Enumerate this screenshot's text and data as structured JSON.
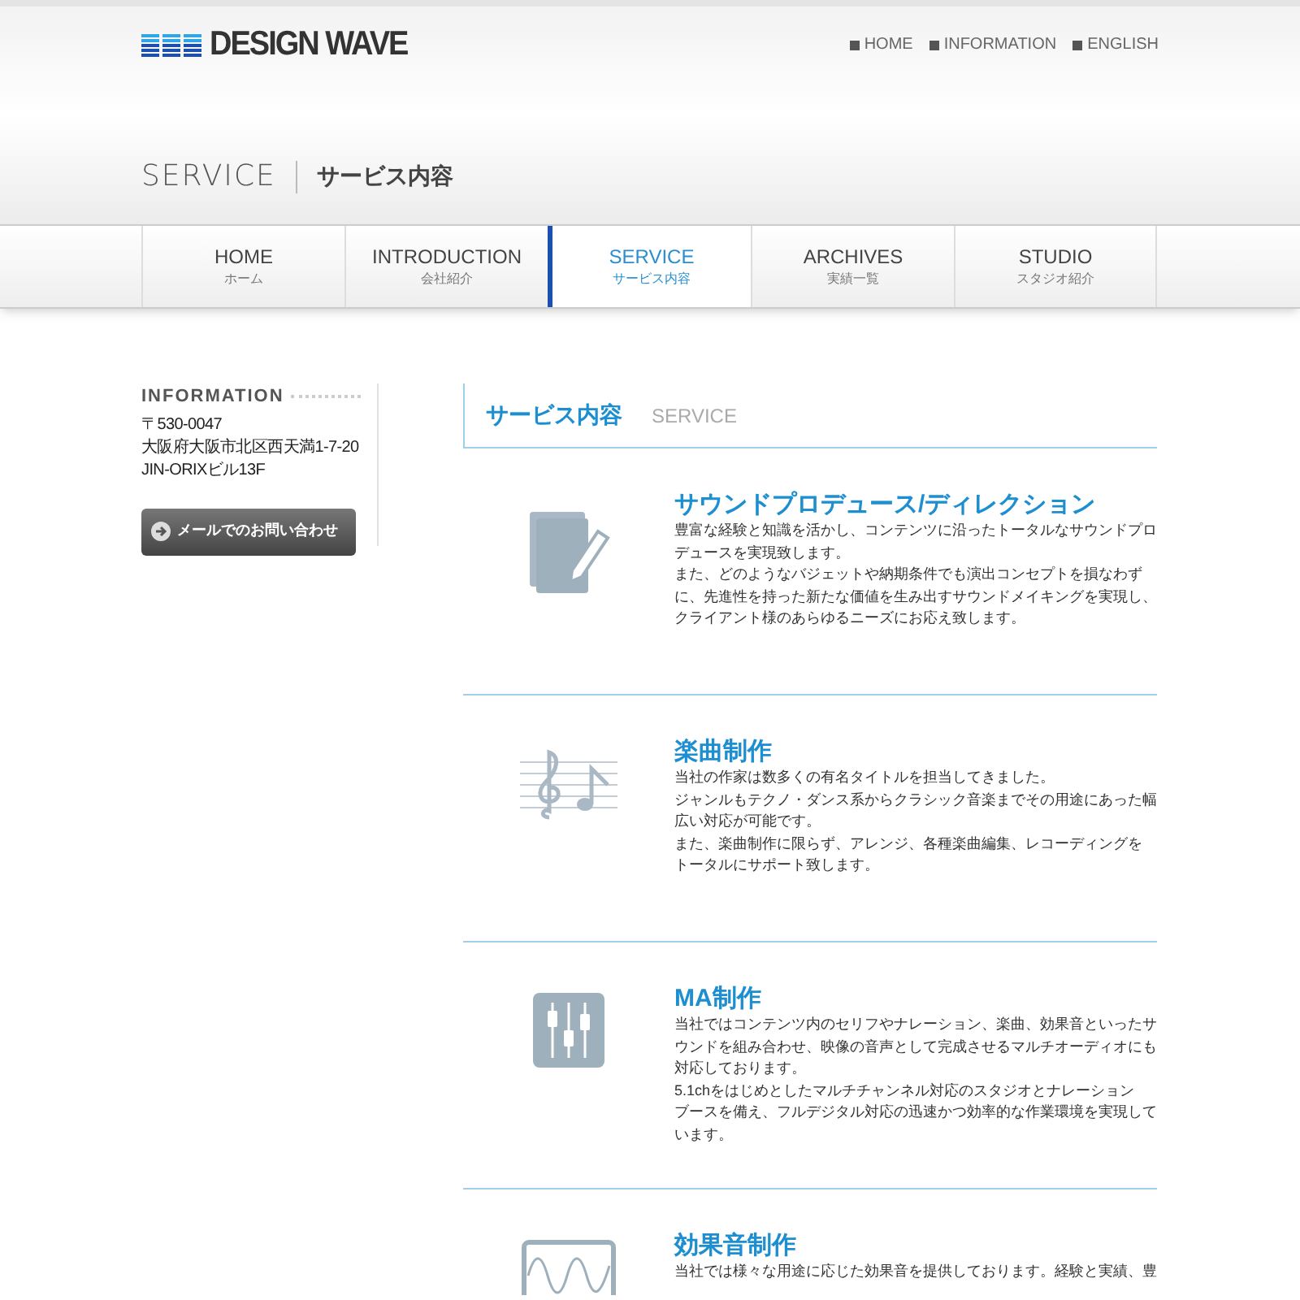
{
  "header": {
    "logo": "DESIGN WAVE",
    "links": [
      "HOME",
      "INFORMATION",
      "ENGLISH"
    ],
    "page_title": "SERVICE",
    "page_subtitle": "サービス内容"
  },
  "nav": [
    {
      "label": "HOME",
      "sub": "ホーム",
      "selected": false
    },
    {
      "label": "INTRODUCTION",
      "sub": "会社紹介",
      "selected": false
    },
    {
      "label": "SERVICE",
      "sub": "サービス内容",
      "selected": true
    },
    {
      "label": "ARCHIVES",
      "sub": "実績一覧",
      "selected": false
    },
    {
      "label": "STUDIO",
      "sub": "スタジオ紹介",
      "selected": false
    }
  ],
  "sidebar": {
    "heading": "INFORMATION",
    "address": [
      "〒530-0047",
      "大阪府大阪市北区西天満1-7-20",
      "JIN-ORIXビル13F"
    ],
    "contact_button": "メールでのお問い合わせ"
  },
  "main": {
    "heading": "サービス内容",
    "heading_en": "SERVICE",
    "sections": [
      {
        "kind": "notebook",
        "title": "サウンドプロデュース/ディレクション",
        "lines": [
          "豊富な経験と知識を活かし、コンテンツに沿ったトータルなサウンドプロ",
          "デュースを実現致します。",
          "また、どのようなバジェットや納期条件でも演出コンセプトを損なわず",
          "に、先進性を持った新たな価値を生み出すサウンドメイキングを実現し、",
          "クライアント様のあらゆるニーズにお応え致します。"
        ]
      },
      {
        "kind": "score",
        "title": "楽曲制作",
        "lines": [
          "当社の作家は数多くの有名タイトルを担当してきました。",
          "ジャンルもテクノ・ダンス系からクラシック音楽までその用途にあった幅",
          "広い対応が可能です。",
          "また、楽曲制作に限らず、アレンジ、各種楽曲編集、レコーディングを",
          "トータルにサポート致します。"
        ]
      },
      {
        "kind": "mixer",
        "title": "MA制作",
        "lines": [
          "当社ではコンテンツ内のセリフやナレーション、楽曲、効果音といったサ",
          "ウンドを組み合わせ、映像の音声として完成させるマルチオーディオにも",
          "対応しております。",
          "5.1chをはじめとしたマルチチャンネル対応のスタジオとナレーション",
          "ブースを備え、フルデジタル対応の迅速かつ効率的な作業環境を実現して",
          "います。"
        ]
      },
      {
        "kind": "wave",
        "title": "効果音制作",
        "lines": [
          "当社では様々な用途に応じた効果音を提供しております。経験と実績、豊"
        ]
      }
    ]
  }
}
